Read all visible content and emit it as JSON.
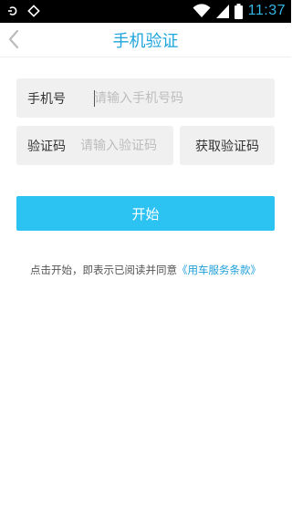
{
  "status_bar": {
    "time": "11:37",
    "left_icons": [
      "notification-icon",
      "alarm-icon"
    ],
    "right_icons": [
      "wifi-icon",
      "signal-icon",
      "battery-icon"
    ]
  },
  "nav": {
    "title": "手机验证",
    "back_icon": "chevron-left-icon",
    "title_color": "#1ea5dc"
  },
  "form": {
    "phone_label": "手机号",
    "phone_placeholder": "请输入手机号码",
    "code_label": "验证码",
    "code_placeholder": "请输入验证码",
    "get_code_label": "获取验证码"
  },
  "start_button": {
    "label": "开始",
    "color": "#2cc3f2"
  },
  "agreement": {
    "prefix": "点击开始，即表示已阅读并同意",
    "link": "《用车服务条款》",
    "link_color": "#1e9fd8"
  }
}
